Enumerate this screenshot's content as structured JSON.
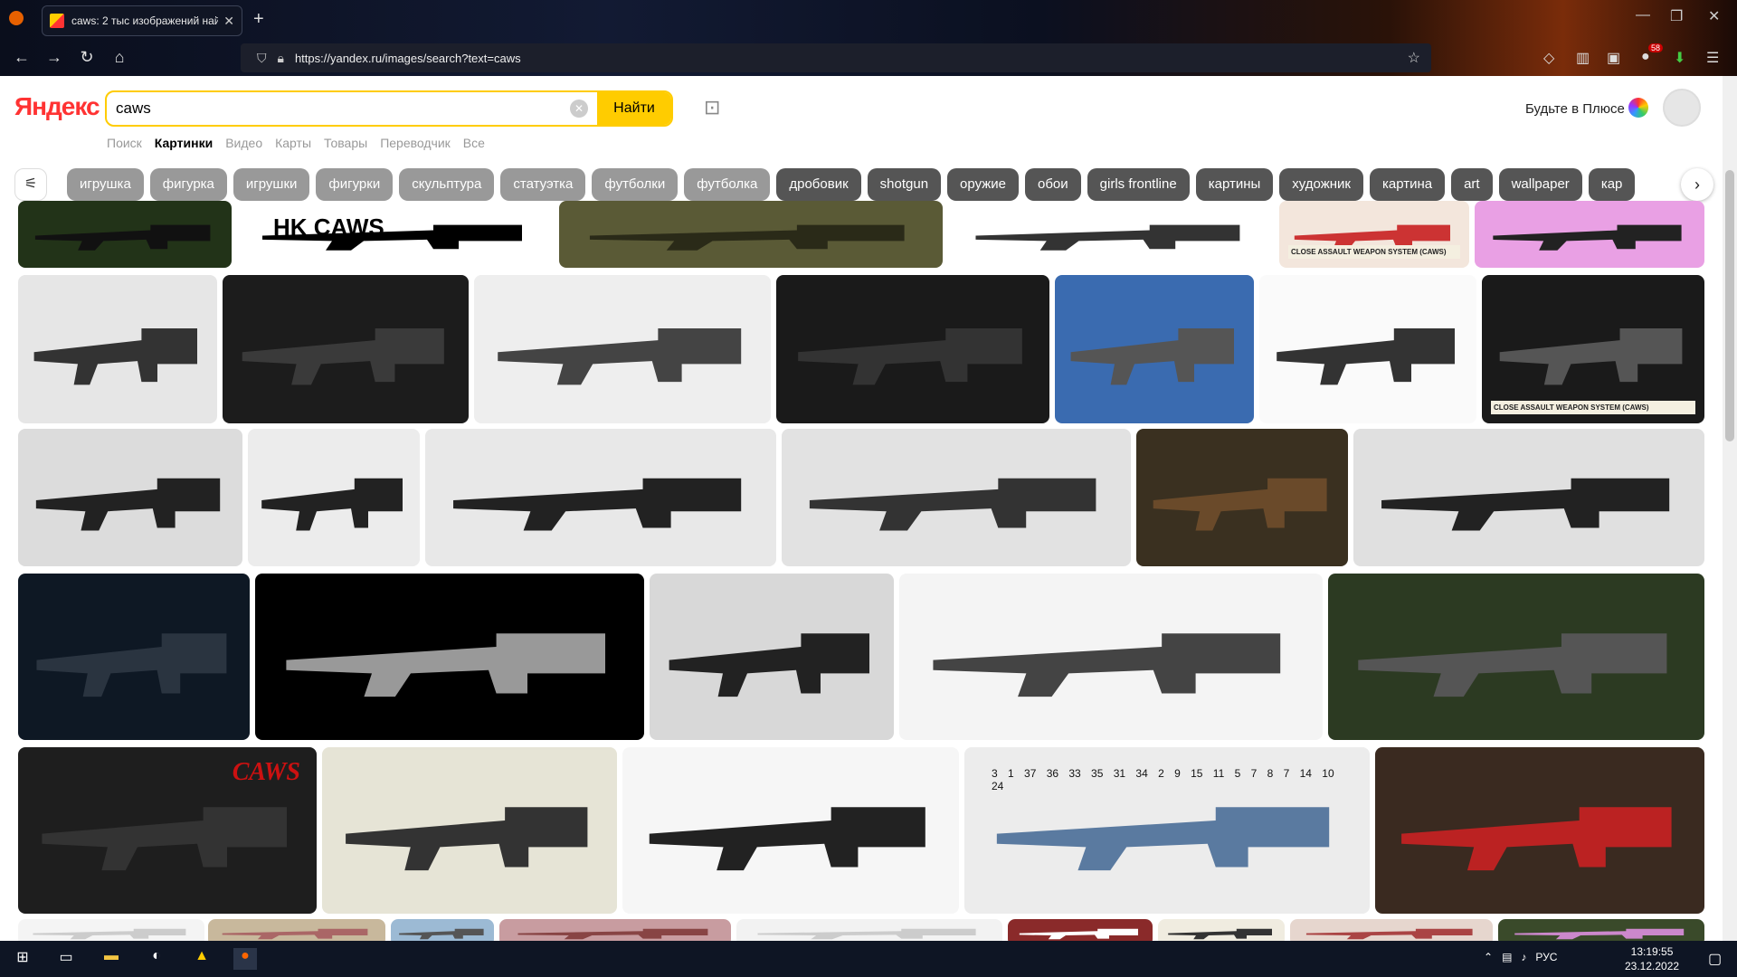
{
  "browser": {
    "tab_title": "caws: 2 тыс изображений най…",
    "url": "https://yandex.ru/images/search?text=caws",
    "badge_count": "58"
  },
  "header": {
    "logo": "Яндекс",
    "search_value": "caws",
    "search_button": "Найти",
    "plus_text": "Будьте в Плюсе"
  },
  "services": [
    "Поиск",
    "Картинки",
    "Видео",
    "Карты",
    "Товары",
    "Переводчик",
    "Все"
  ],
  "chips": [
    {
      "label": "игрушка",
      "dark": false
    },
    {
      "label": "фигурка",
      "dark": false
    },
    {
      "label": "игрушки",
      "dark": false
    },
    {
      "label": "фигурки",
      "dark": false
    },
    {
      "label": "скульптура",
      "dark": false
    },
    {
      "label": "статуэтка",
      "dark": false
    },
    {
      "label": "футболки",
      "dark": false
    },
    {
      "label": "футболка",
      "dark": false
    },
    {
      "label": "дробовик",
      "dark": true
    },
    {
      "label": "shotgun",
      "dark": true
    },
    {
      "label": "оружие",
      "dark": true
    },
    {
      "label": "обои",
      "dark": true
    },
    {
      "label": "girls frontline",
      "dark": true
    },
    {
      "label": "картины",
      "dark": true
    },
    {
      "label": "художник",
      "dark": true
    },
    {
      "label": "картина",
      "dark": true
    },
    {
      "label": "art",
      "dark": true
    },
    {
      "label": "wallpaper",
      "dark": true
    },
    {
      "label": "кар",
      "dark": true
    }
  ],
  "image_captions": {
    "hk_caws": "HK CAWS",
    "caws_logo": "CAWS",
    "close_assault": "CLOSE ASSAULT WEAPON SYSTEM (CAWS)",
    "diagram_numbers": "3 1 37 36 33 35 31 34 2 9 15 11 5 7 8 7 14 10 24"
  },
  "taskbar": {
    "lang": "РУС",
    "time": "13:19:55",
    "date": "23.12.2022"
  },
  "colors": {
    "accent": "#ffcc00",
    "logo_red": "#ff3333"
  }
}
